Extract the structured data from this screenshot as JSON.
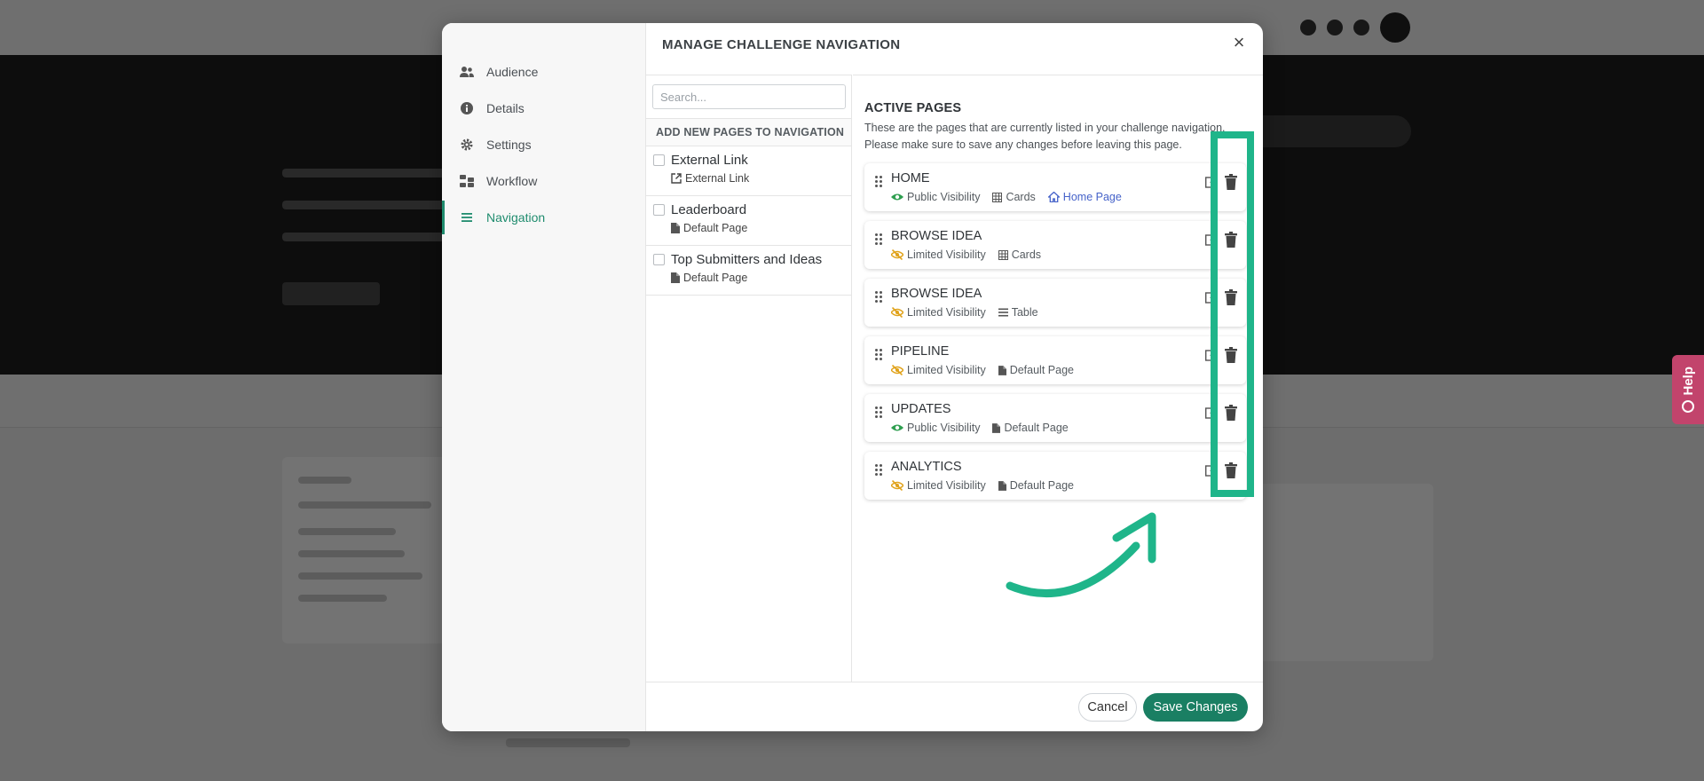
{
  "modal": {
    "title": "MANAGE CHALLENGE NAVIGATION",
    "close_label": "×",
    "sidebar": [
      {
        "label": "Audience",
        "icon": "users-icon",
        "active": false
      },
      {
        "label": "Details",
        "icon": "info-circle-icon",
        "active": false
      },
      {
        "label": "Settings",
        "icon": "gear-icon",
        "active": false
      },
      {
        "label": "Workflow",
        "icon": "workflow-icon",
        "active": false
      },
      {
        "label": "Navigation",
        "icon": "list-icon",
        "active": true
      }
    ],
    "search": {
      "placeholder": "Search...",
      "value": ""
    },
    "add_pages": {
      "header": "ADD NEW PAGES TO NAVIGATION",
      "items": [
        {
          "title": "External Link",
          "subtitle": "External Link",
          "icon": "external-link-icon"
        },
        {
          "title": "Leaderboard",
          "subtitle": "Default Page",
          "icon": "file-icon"
        },
        {
          "title": "Top Submitters and Ideas",
          "subtitle": "Default Page",
          "icon": "file-icon"
        }
      ]
    },
    "active_pages": {
      "title": "ACTIVE PAGES",
      "description_line1": "These are the pages that are currently listed in your challenge navigation.",
      "description_line2": "Please make sure to save any changes before leaving this page.",
      "items": [
        {
          "title": "HOME",
          "visibility": "Public Visibility",
          "visibility_icon": "eye-icon",
          "type": "Cards",
          "type_icon": "table-icon",
          "extra": "Home Page",
          "extra_icon": "home-icon"
        },
        {
          "title": "BROWSE IDEA",
          "visibility": "Limited Visibility",
          "visibility_icon": "eye-slash-icon",
          "type": "Cards",
          "type_icon": "table-icon"
        },
        {
          "title": "BROWSE IDEA",
          "visibility": "Limited Visibility",
          "visibility_icon": "eye-slash-icon",
          "type": "Table",
          "type_icon": "list-icon"
        },
        {
          "title": "PIPELINE",
          "visibility": "Limited Visibility",
          "visibility_icon": "eye-slash-icon",
          "type": "Default Page",
          "type_icon": "file-icon"
        },
        {
          "title": "UPDATES",
          "visibility": "Public Visibility",
          "visibility_icon": "eye-icon",
          "type": "Default Page",
          "type_icon": "file-icon"
        },
        {
          "title": "ANALYTICS",
          "visibility": "Limited Visibility",
          "visibility_icon": "eye-slash-icon",
          "type": "Default Page",
          "type_icon": "file-icon"
        }
      ]
    },
    "footer": {
      "cancel_label": "Cancel",
      "save_label": "Save Changes"
    }
  },
  "help_tab": {
    "label": "Help"
  },
  "colors": {
    "accent": "#1f8c6e",
    "save_button": "#1a7f63",
    "highlight": "#1fb58a",
    "public_eye": "#2e9e4f",
    "limited_eye": "#e0a21a",
    "home_link": "#4562c9",
    "help_tab": "#c2446c"
  }
}
